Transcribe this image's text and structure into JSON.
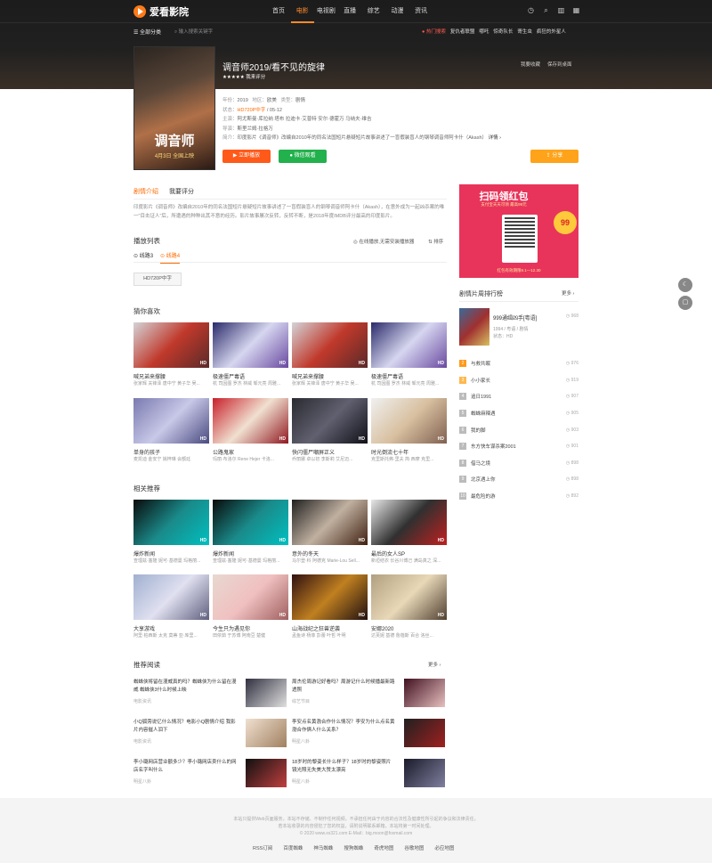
{
  "brand": {
    "name": "爱看影院"
  },
  "nav": {
    "items": [
      "首页",
      "电影",
      "电视剧",
      "直播",
      "综艺",
      "动漫",
      "资讯"
    ],
    "active": 1
  },
  "subbar": {
    "category": "☰ 全部分类",
    "search_placeholder": "⌕ 输入搜索关键字",
    "hot_label": "● 热门搜索",
    "hot": [
      "复仇者联盟",
      "哪吒",
      "惊奇队长",
      "寄生虫",
      "疯狂的外星人"
    ]
  },
  "movie": {
    "title": "调音师2019/看不见的旋律",
    "stars": "★★★★★",
    "rating_link": "我来评分",
    "poster_title": "调音师",
    "poster_sub": "4月3日 全国上映",
    "links": [
      "我要收藏",
      "保存到桌面"
    ],
    "year_label": "年份：",
    "year": "2019",
    "area_label": "地区：",
    "area": "欧美",
    "type_label": "类型：",
    "type": "剧情",
    "status_label": "状态：",
    "status": "HD720P中字",
    "date": " / 05-12",
    "cast_label": "主演：",
    "cast": "阿尤斯曼·库拉纳 塔布 拉迪卡·艾普特 安尔·德霍万 马纳夫·维吉",
    "director_label": "导演：",
    "director": "斯里兰姆·拉格万",
    "intro_label": "简介：",
    "intro": "印度影片《调音师》改编自2010年的同名法国短片悬疑短片故事讲述了一盲假装盲人的钢琴调音师阿卡什（Akash）",
    "intro_more": "详情 ›",
    "btn_play": "▶ 立即播放",
    "btn_wechat": "● 微信观看",
    "btn_share": "⇪ 分享"
  },
  "tabs": {
    "plot": "剧情介绍",
    "rate": "我要评分"
  },
  "description": "印度影片《调音师》改编自2010年的同名法国短片悬疑短片故事讲述了一盲假装盲人的钢琴调音师阿卡什（Akash），在意外成为一起凶杀案的唯一\"目击证人\"后，所遭遇的种种出其不意的经历。影片故事屡次反转，反转不断，是2018年度IMDB评分最高的印度影片。",
  "playlist": {
    "title": "播放列表",
    "note": "◎ 在线播放,无需安装播放器",
    "sort": "⇅ 排序",
    "lines": [
      "⊙ 线路3",
      "⊙ 线路4"
    ],
    "episode": "HD720P中字"
  },
  "guess": {
    "title": "猜你喜欢",
    "items": [
      {
        "title": "喊兄弟来撑腰",
        "sub": "张家辉 关锋泽 唐中宁 黄子华 吴..."
      },
      {
        "title": "极速僵尸毒语",
        "sub": "杭 司因图 罗杰 林威 邹元亮 周雅..."
      },
      {
        "title": "喊兄弟来撑腰",
        "sub": "张家辉 关锋泽 唐中宁 黄子华 吴..."
      },
      {
        "title": "极速僵尸毒语",
        "sub": "杭 司因图 罗杰 林威 邹元亮 周雅..."
      },
      {
        "title": "单身的孩子",
        "sub": "麦凯迪 金安宁 姚梓琳 会额廷"
      },
      {
        "title": "公路鬼家",
        "sub": "玛丽·布洛尔 Rene Hejer 卡洛..."
      },
      {
        "title": "快闪僵尸嘲屏正义",
        "sub": "乔丽娜 卓以初 李斯莉 艾尼迈..."
      },
      {
        "title": "时光倒流七十年",
        "sub": "克里斯托弗·里夫 简·西摩 克里..."
      }
    ]
  },
  "related": {
    "title": "相关推荐",
    "items": [
      {
        "title": "爆炸新闻",
        "sub": "查理兹·塞隆 妮可·基德曼 玛格丽..."
      },
      {
        "title": "爆炸新闻",
        "sub": "查理兹·塞隆 妮可·基德曼 玛格丽..."
      },
      {
        "title": "意外的冬天",
        "sub": "马尔登·科 阿德克 Marie-Lou Sell..."
      },
      {
        "title": "最后的女人SP",
        "sub": "新垣结衣 长谷川博己 满岛真之 深..."
      },
      {
        "title": "大享游戏",
        "sub": "阿里·柏西斯 太克 莫蒂 亚·库里..."
      },
      {
        "title": "今生只为遇见你",
        "sub": "田依茹 于苏博 阿南豆 楚健"
      },
      {
        "title": "山海战纪之狂兽逆袭",
        "sub": "孟鱼诗 杨菲 彭蕾 叶哲 叶明"
      },
      {
        "title": "安娜2020",
        "sub": "达芙妮 基德 詹蓓斯 百合 洛丝..."
      }
    ]
  },
  "reading": {
    "title": "推荐阅读",
    "more": "更多 ›",
    "items": [
      {
        "text": "蜘蛛侠将留在漫威真的吗？蜘蛛侠为什么留在漫威 蜘蛛侠3什么时候上映",
        "src": "电影资讯"
      },
      {
        "text": "周杰伦周游记好看吗？周游记什么时候播最新路透照",
        "src": "综艺节目"
      },
      {
        "text": "小Q狐旁说亿什么情况？电影小Q剧情介绍 我影片内容催人泪下",
        "src": "电影资讯"
      },
      {
        "text": "李安点名黄渤合作什么情况？李安为什么点名黄渤合作俩人什么关系？",
        "src": "明星八卦"
      },
      {
        "text": "李小璐网店营业额多少？李小璐网店卖什么的网店名字叫什么",
        "src": "明星八卦"
      },
      {
        "text": "18岁时的黎姿长什么样子？18岁时的黎姿照片镜光照无失美大赞太漂亮",
        "src": "明星八卦"
      }
    ]
  },
  "ad": {
    "title": "扫码领红包",
    "sub": "支付宝天天可领 最高99元",
    "coin": "99",
    "foot": "红包有效期限9.1—12.30"
  },
  "rank": {
    "title": "剧情片周排行榜",
    "more": "更多 ›",
    "top": {
      "title": "999通缉凶手[粤语]",
      "meta1": "1994 / 粤语 / 剧情",
      "meta2": "状态：HD",
      "count": "◷ 968"
    },
    "items": [
      {
        "no": "2",
        "title": "与救共眠",
        "count": "◷ 976"
      },
      {
        "no": "3",
        "title": "小小家长",
        "count": "◷ 919"
      },
      {
        "no": "4",
        "title": "追日1991",
        "count": "◷ 907"
      },
      {
        "no": "5",
        "title": "蜘蛛麻辣遇",
        "count": "◷ 905"
      },
      {
        "no": "6",
        "title": "我的脚",
        "count": "◷ 903"
      },
      {
        "no": "7",
        "title": "东方快车谋杀案2001",
        "count": "◷ 901"
      },
      {
        "no": "8",
        "title": "借马之境",
        "count": "◷ 898"
      },
      {
        "no": "9",
        "title": "北京遇上你",
        "count": "◷ 898"
      },
      {
        "no": "10",
        "title": "最危险的游",
        "count": "◷ 892"
      }
    ]
  },
  "footer": {
    "l1": "本站只提供Web页面服务，本站不存储、不制作任何视频，不承担任何由于内容的合法性及健康性所引起的争议和法律责任。",
    "l2": "若本站收录的内容侵犯了您的权益，请附说明联系邮箱，本站将第一时间处理。",
    "l3": "© 2020 www.xx321.com  E-Mail：big.moon@foxmail.com",
    "links": [
      "RSS订阅",
      "百度蜘蛛",
      "神马蜘蛛",
      "搜狗蜘蛛",
      "奇虎地图",
      "谷歌地图",
      "必应地图"
    ]
  }
}
